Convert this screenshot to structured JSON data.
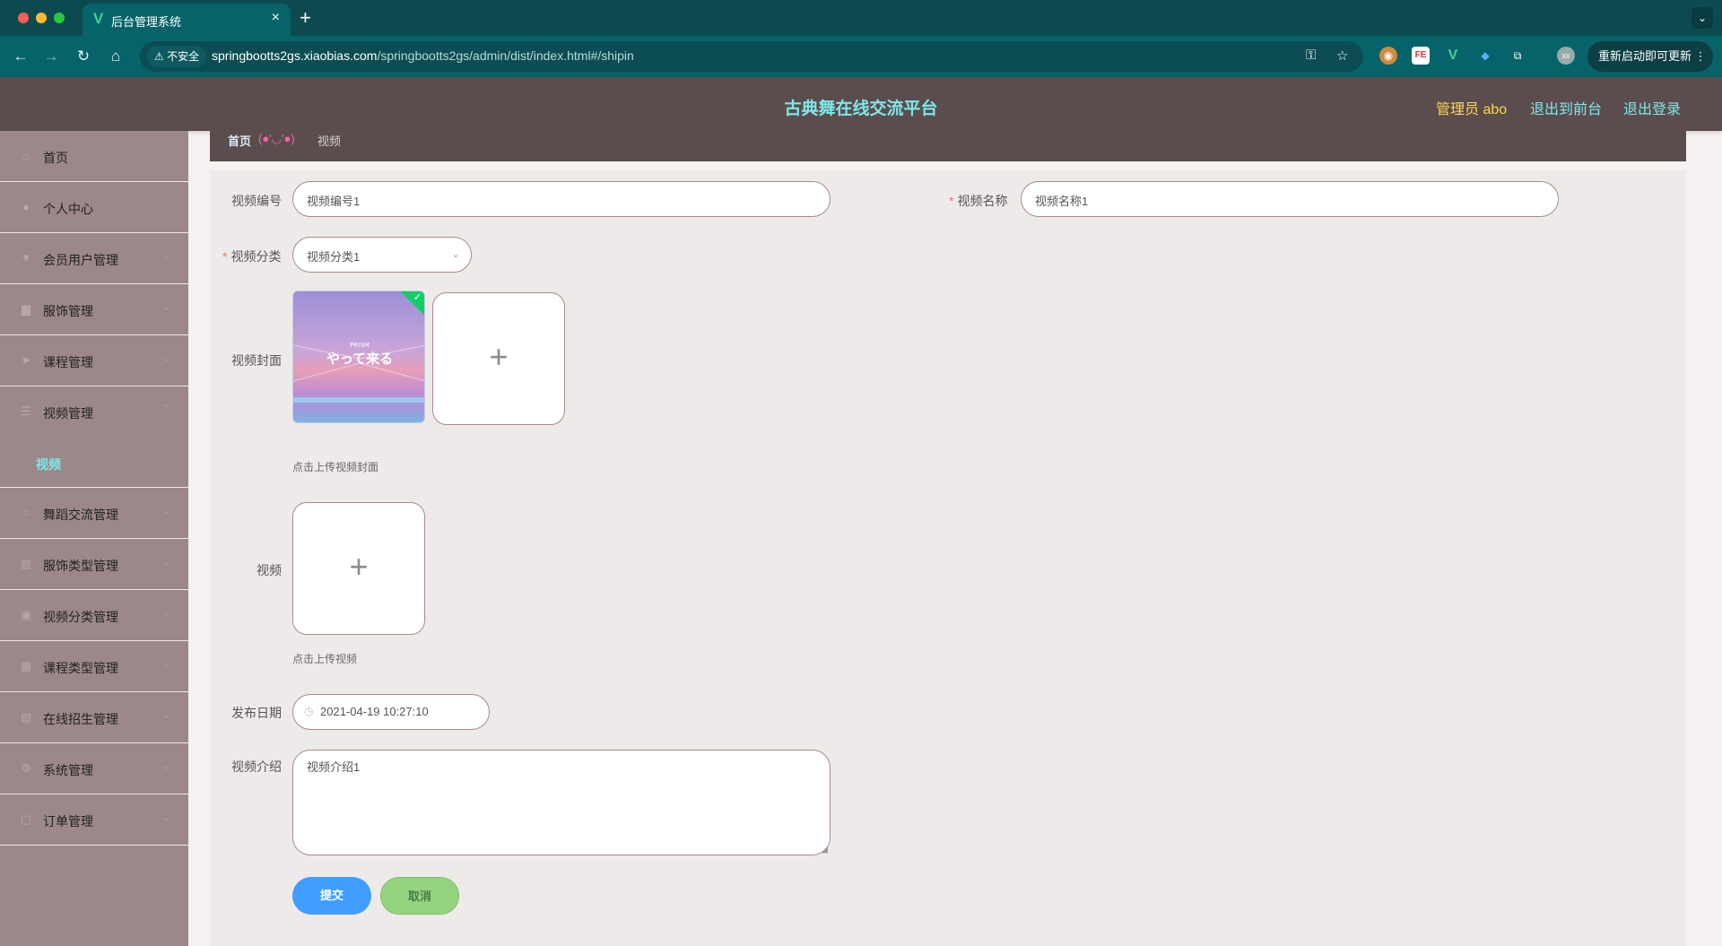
{
  "browser": {
    "tab_title": "后台管理系统",
    "new_tab": "+",
    "insecure_label": "不安全",
    "url_host": "springbootts2gs.xiaobias.com",
    "url_path": "/springbootts2gs/admin/dist/index.html#/shipin",
    "update_button": "重新启动即可更新",
    "ext_fe": "FE",
    "profile": "xx"
  },
  "header": {
    "title": "古典舞在线交流平台",
    "user_label": "管理员 abo",
    "front_link": "退出到前台",
    "logout_link": "退出登录"
  },
  "sidebar": {
    "items": [
      {
        "label": "首页"
      },
      {
        "label": "个人中心"
      },
      {
        "label": "会员用户管理"
      },
      {
        "label": "服饰管理"
      },
      {
        "label": "课程管理"
      },
      {
        "label": "视频管理"
      },
      {
        "label": "舞蹈交流管理"
      },
      {
        "label": "服饰类型管理"
      },
      {
        "label": "视频分类管理"
      },
      {
        "label": "课程类型管理"
      },
      {
        "label": "在线招生管理"
      },
      {
        "label": "系统管理"
      },
      {
        "label": "订单管理"
      }
    ],
    "sub_active": "视频"
  },
  "breadcrumb": {
    "home": "首页",
    "emoji": "(●'◡'●)",
    "current": "视频"
  },
  "form": {
    "video_no_label": "视频编号",
    "video_no_value": "视频编号1",
    "video_name_label": "视频名称",
    "video_name_value": "视频名称1",
    "category_label": "视频分类",
    "category_value": "视频分类1",
    "cover_label": "视频封面",
    "cover_hint": "点击上传视频封面",
    "video_label": "视频",
    "video_hint": "点击上传视频",
    "date_label": "发布日期",
    "date_value": "2021-04-19 10:27:10",
    "intro_label": "视频介绍",
    "intro_value": "视频介绍1",
    "submit": "提交",
    "cancel": "取消"
  },
  "cover_image": {
    "text_small": "PRISM",
    "text_main": "やって来る"
  },
  "colors": {
    "header_bg": "#5b4d4d",
    "sidebar_bg": "#9c8888",
    "accent_cyan": "#7fe7ea",
    "user_yellow": "#ffd84d",
    "submit_blue": "#409eff",
    "cancel_green": "#95d47f"
  }
}
